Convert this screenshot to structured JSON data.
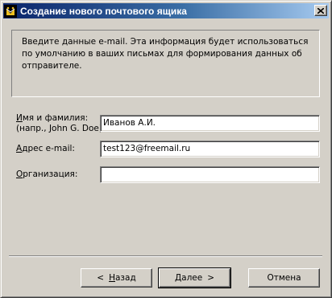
{
  "window": {
    "title": "Создание нового почтового ящика",
    "icon": "mail-wizard-icon"
  },
  "info": {
    "text": "Введите данные e-mail. Эта информация будет использоваться по умолчанию в ваших письмах для формирования данных об отправителе."
  },
  "form": {
    "name_label_underlined": "И",
    "name_label_rest": "мя и фамилия:",
    "name_hint": "(напр., John G. Doe)",
    "name_value": "Иванов А.И.",
    "email_label_underlined": "А",
    "email_label_rest": "дрес e-mail:",
    "email_value": "test123@freemail.ru",
    "org_label_underlined": "О",
    "org_label_rest": "рганизация:",
    "org_value": ""
  },
  "buttons": {
    "back_arrow": "<",
    "back_underlined": "Н",
    "back_rest": "азад",
    "next_underlined": "Д",
    "next_rest": "алее",
    "next_arrow": ">",
    "cancel": "Отмена"
  }
}
